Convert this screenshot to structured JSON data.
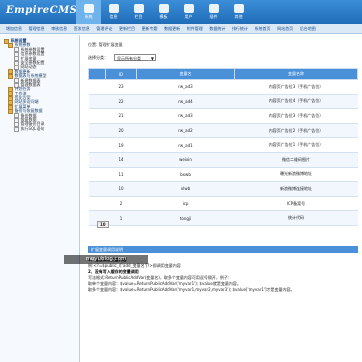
{
  "app": {
    "logo_text": "EmpireCMS"
  },
  "topnav": [
    {
      "label": "系统",
      "active": true
    },
    {
      "label": "信息",
      "active": false
    },
    {
      "label": "栏目",
      "active": false
    },
    {
      "label": "模板",
      "active": false
    },
    {
      "label": "用户",
      "active": false
    },
    {
      "label": "插件",
      "active": false
    },
    {
      "label": "其他",
      "active": false
    }
  ],
  "subnav": [
    "增加信息",
    "管理信息",
    "审核信息",
    "签发信息",
    "管理评论",
    "更新栏目",
    "更新专题",
    "数据更新",
    "附件管理",
    "数据统计",
    "排行统计",
    "系统首页",
    "网站首页",
    "后台地图"
  ],
  "sidebar": [
    {
      "label": "系统设置",
      "level": 0
    },
    {
      "label": "系统参数",
      "level": 1
    },
    {
      "label": "系统参数设置",
      "level": 2
    },
    {
      "label": "信息参数设置",
      "level": 2
    },
    {
      "label": "扩展变量",
      "level": 2
    },
    {
      "label": "安全参数配置",
      "level": 2
    },
    {
      "label": "网站动态",
      "level": 2
    },
    {
      "label": "数据更新",
      "level": 1
    },
    {
      "label": "数据表与系统模型",
      "level": 1
    },
    {
      "label": "新建数据表",
      "level": 2
    },
    {
      "label": "管理数据表",
      "level": 2
    },
    {
      "label": "计划任务",
      "level": 1
    },
    {
      "label": "工作流",
      "level": 1
    },
    {
      "label": "优化方案",
      "level": 1
    },
    {
      "label": "网站多访问端",
      "level": 1
    },
    {
      "label": "扩展菜单",
      "level": 1
    },
    {
      "label": "备份与恢复数据",
      "level": 1
    },
    {
      "label": "备份数据",
      "level": 2
    },
    {
      "label": "恢复数据",
      "level": 2
    },
    {
      "label": "管理备份目录",
      "level": 2
    },
    {
      "label": "执行SQL语句",
      "level": 2
    }
  ],
  "main": {
    "position": "位置: 管理扩展变量",
    "category_label": "选择分类：",
    "category_value": "显示所有分类"
  },
  "table": {
    "columns": [
      "",
      "ID",
      "变量名",
      "变量名称"
    ],
    "rows": [
      {
        "id": "23",
        "name": "rw_ad3",
        "desc": "内容页广告位3（手机广告位）"
      },
      {
        "id": "22",
        "name": "rw_ad4",
        "desc": "内容页广告位4（手机广告位）"
      },
      {
        "id": "21",
        "name": "rw_ad3",
        "desc": "内容页广告位3（手机广告位）"
      },
      {
        "id": "20",
        "name": "rw_ad2",
        "desc": "内容页广告位2（手机广告位）"
      },
      {
        "id": "19",
        "name": "rw_ad1",
        "desc": "内容页广告位1（手机广告位）"
      },
      {
        "id": "14",
        "name": "weixin",
        "desc": "微信二维码图片"
      },
      {
        "id": "11",
        "name": "bxwb",
        "desc": "曝光新浪微博地址"
      },
      {
        "id": "10",
        "name": "xlwb",
        "desc": "新浪微博连接地址"
      },
      {
        "id": "2",
        "name": "icp",
        "desc": "ICP备案号"
      },
      {
        "id": "1",
        "name": "tongji",
        "desc": "统计代码"
      }
    ]
  },
  "pager": "10",
  "panel_title": "扩展变量调用说明",
  "desc": {
    "h1": "1、直接调用变量内容",
    "l1": "例:<?=$public_r['add_变量名']?>即调用变量内容",
    "h2": "2、没有写入缓存的变量调用",
    "l2": "写法格式:ReturnPublicAddVar(变量名)，取多个变量内容可用逗号隔开，例子：",
    "l3": "取单个变量内容：$value=ReturnPublicAddVar('myvar1'); $value就是变量内容。",
    "l4": "取多个变量内容：$value=ReturnPublicAddVar('myvar1,myvar2,myvar3'); $value['myvar1']才是变量内容。"
  },
  "watermark": "moyublog.com"
}
